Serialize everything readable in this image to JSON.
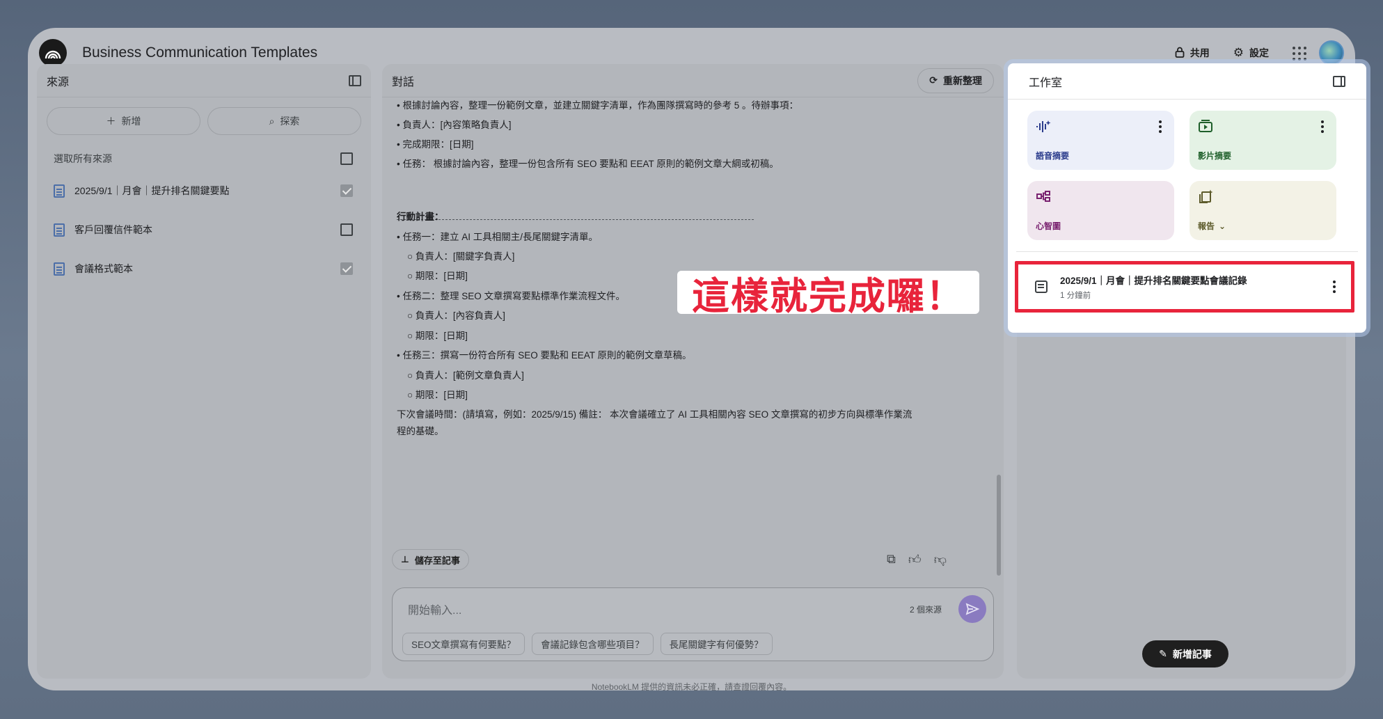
{
  "header": {
    "title": "Business Communication Templates",
    "share_label": "共用",
    "settings_label": "設定"
  },
  "sources": {
    "title": "來源",
    "add_label": "新增",
    "discover_label": "探索",
    "select_all_label": "選取所有來源",
    "items": [
      {
        "label": "2025/9/1｜月會｜提升排名關鍵要點",
        "checked": true
      },
      {
        "label": "客戶回覆信件範本",
        "checked": false
      },
      {
        "label": "會議格式範本",
        "checked": true
      }
    ]
  },
  "chat": {
    "title": "對話",
    "regenerate_label": "重新整理",
    "lines": [
      "• 根據討論內容，整理一份範例文章，並建立關鍵字清單，作為團隊撰寫時的參考 5 。待辦事項：",
      "• 負責人：[內容策略負責人]",
      "• 完成期限：[日期]",
      "• 任務： 根據討論內容，整理一份包含所有 SEO 要點和 EEAT 原則的範例文章大綱或初稿。",
      "行動計畫：",
      "• 任務一：建立 AI 工具相關主/長尾關鍵字清單。",
      "○ 負責人：[關鍵字負責人]",
      "○ 期限：[日期]",
      "• 任務二：整理 SEO 文章撰寫要點標準作業流程文件。",
      "○ 負責人：[內容負責人]",
      "○ 期限：[日期]",
      "• 任務三：撰寫一份符合所有 SEO 要點和 EEAT 原則的範例文章草稿。",
      "○ 負責人：[範例文章負責人]",
      "○ 期限：[日期]",
      "下次會議時間：(請填寫，例如：2025/9/15) 備註： 本次會議確立了 AI 工具相關內容 SEO 文章撰寫的初步方向與標準作業流",
      "程的基礎。"
    ],
    "save_note_label": "儲存至記事",
    "input_placeholder": "開始輸入...",
    "source_count": "2 個來源",
    "suggestions": [
      "SEO文章撰寫有何要點？",
      "會議記錄包含哪些項目？",
      "長尾關鍵字有何優勢？"
    ]
  },
  "disclaimer": "NotebookLM 提供的資訊未必正確，請查證回覆內容。",
  "studio": {
    "title": "工作室",
    "tiles": [
      {
        "label": "語音摘要",
        "icon": "audio-waveform-icon"
      },
      {
        "label": "影片摘要",
        "icon": "video-icon"
      },
      {
        "label": "心智圖",
        "icon": "mindmap-icon"
      },
      {
        "label": "報告",
        "icon": "report-icon"
      }
    ],
    "note": {
      "title": "2025/9/1｜月會｜提升排名關鍵要點會議記錄",
      "time": "1 分鐘前"
    },
    "add_note_label": "新增記事"
  },
  "overlay": {
    "text": "這樣就完成囉！"
  },
  "colors": {
    "accent_red": "#e8243b",
    "send_purple": "#8a7bc0"
  }
}
